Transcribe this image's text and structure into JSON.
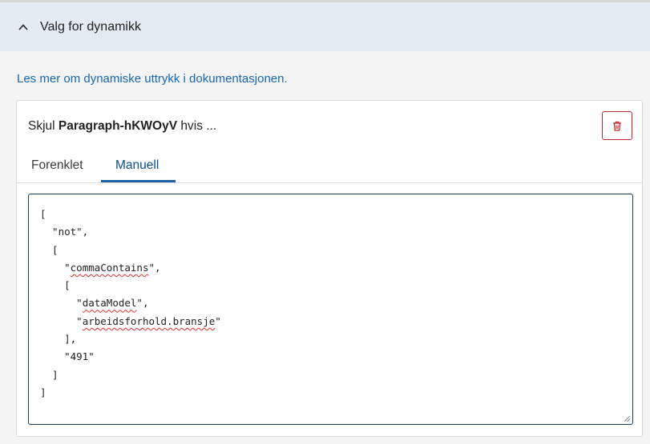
{
  "accordion": {
    "title": "Valg for dynamikk",
    "icon": "chevron-up-icon"
  },
  "doc_link": "Les mer om dynamiske uttrykk i dokumentasjonen.",
  "card": {
    "title_prefix": "Skjul",
    "component_id": "Paragraph-hKWOyV",
    "title_suffix": "hvis ...",
    "delete_icon": "trash-icon",
    "tabs": [
      {
        "label": "Forenklet",
        "active": false
      },
      {
        "label": "Manuell",
        "active": true
      }
    ]
  },
  "editor": {
    "lines": [
      "[",
      "  \"not\",",
      "  [",
      "    \"commaContains\",",
      "    [",
      "      \"dataModel\",",
      "      \"arbeidsforhold.bransje\"",
      "    ],",
      "    \"491\"",
      "  ]",
      "]"
    ],
    "spellcheck_flagged": [
      "commaContains",
      "dataModel",
      "arbeidsforhold.bransje"
    ]
  },
  "colors": {
    "accent": "#1d5fa3",
    "link": "#1a67b1",
    "danger": "#c1272d",
    "header_bg": "#e3ecf5"
  }
}
